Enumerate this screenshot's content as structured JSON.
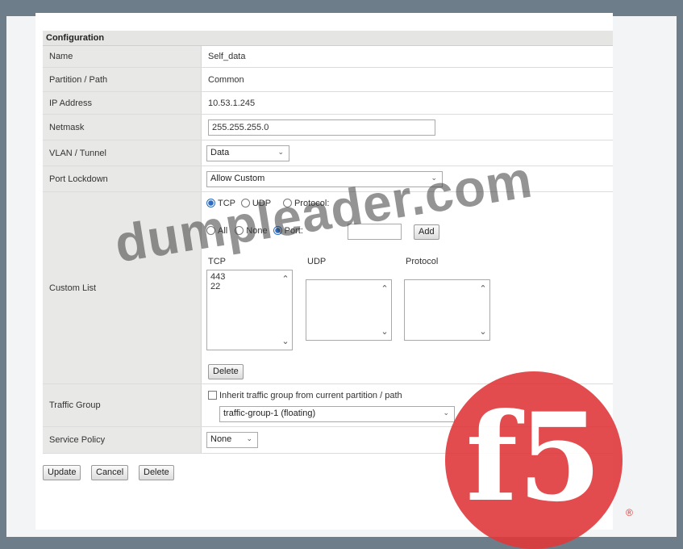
{
  "section_title": "Configuration",
  "rows": {
    "name": {
      "label": "Name",
      "value": "Self_data"
    },
    "partition": {
      "label": "Partition / Path",
      "value": "Common"
    },
    "ip": {
      "label": "IP Address",
      "value": "10.53.1.245"
    },
    "netmask": {
      "label": "Netmask",
      "value": "255.255.255.0"
    },
    "vlan": {
      "label": "VLAN / Tunnel",
      "value": "Data"
    },
    "port_lockdown": {
      "label": "Port Lockdown",
      "value": "Allow Custom"
    },
    "custom_list": {
      "label": "Custom List",
      "proto_tcp": "TCP",
      "proto_udp": "UDP",
      "proto_protocol": "Protocol:",
      "port_all": "All",
      "port_none": "None",
      "port_port": "Port:",
      "port_value": "",
      "add": "Add",
      "col_tcp": "TCP",
      "col_udp": "UDP",
      "col_protocol": "Protocol",
      "tcp_items": [
        "443",
        "22"
      ],
      "delete": "Delete"
    },
    "traffic_group": {
      "label": "Traffic Group",
      "inherit": "Inherit traffic group from current partition / path",
      "value": "traffic-group-1 (floating)"
    },
    "service_policy": {
      "label": "Service Policy",
      "value": "None"
    }
  },
  "actions": {
    "update": "Update",
    "cancel": "Cancel",
    "delete": "Delete"
  },
  "watermark": "dumpleader.com",
  "logo": {
    "text": "f5",
    "registered": "®",
    "color": "#e0393b"
  },
  "icons": {
    "dropdown": "chevron-down-icon",
    "scroll_up": "chevron-up-icon",
    "scroll_down": "chevron-down-icon"
  }
}
